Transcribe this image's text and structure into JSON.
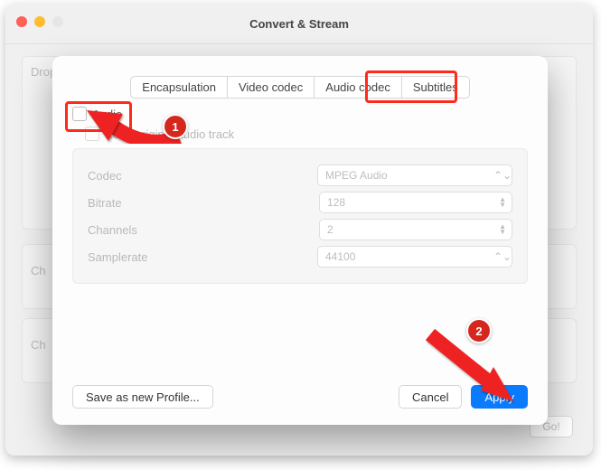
{
  "window": {
    "title": "Convert & Stream",
    "drop_hint": "Drop media here",
    "choose_label1": "Ch",
    "choose_label2": "Ch",
    "go_label": "Go!"
  },
  "sheet": {
    "tabs": {
      "encapsulation": "Encapsulation",
      "video_codec": "Video codec",
      "audio_codec": "Audio codec",
      "subtitles": "Subtitles"
    },
    "audio": {
      "toggle_label": "Audio",
      "keep_label": "Keep original audio track",
      "codec_label": "Codec",
      "codec_value": "MPEG Audio",
      "bitrate_label": "Bitrate",
      "bitrate_value": "128",
      "channels_label": "Channels",
      "channels_value": "2",
      "samplerate_label": "Samplerate",
      "samplerate_value": "44100"
    },
    "buttons": {
      "save_profile": "Save as new Profile...",
      "cancel": "Cancel",
      "apply": "Apply"
    }
  },
  "annotations": {
    "badge1": "1",
    "badge2": "2"
  }
}
